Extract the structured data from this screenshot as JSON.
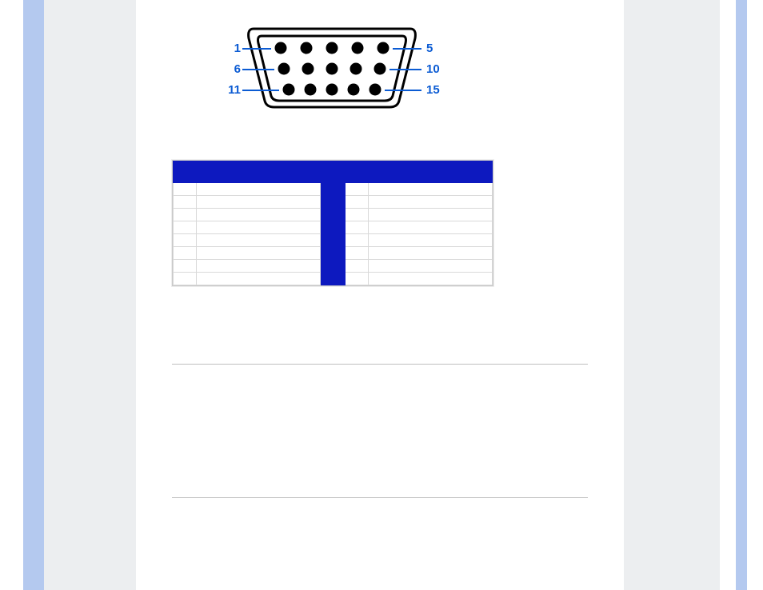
{
  "diagram": {
    "labels": {
      "p1": "1",
      "p5": "5",
      "p6": "6",
      "p10": "10",
      "p11": "11",
      "p15": "15"
    }
  },
  "table": {
    "headers": {
      "num": "",
      "sig": "",
      "num2": "",
      "sig2": ""
    },
    "rows_left": [
      {
        "n": "",
        "s": ""
      },
      {
        "n": "",
        "s": ""
      },
      {
        "n": "",
        "s": ""
      },
      {
        "n": "",
        "s": ""
      },
      {
        "n": "",
        "s": ""
      },
      {
        "n": "",
        "s": ""
      },
      {
        "n": "",
        "s": ""
      },
      {
        "n": "",
        "s": ""
      }
    ],
    "rows_right": [
      {
        "n": "",
        "s": ""
      },
      {
        "n": "",
        "s": ""
      },
      {
        "n": "",
        "s": ""
      },
      {
        "n": "",
        "s": ""
      },
      {
        "n": "",
        "s": ""
      },
      {
        "n": "",
        "s": ""
      },
      {
        "n": "",
        "s": ""
      },
      {
        "n": "",
        "s": ""
      }
    ]
  }
}
